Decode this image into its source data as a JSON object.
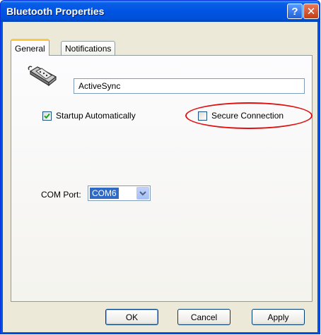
{
  "window": {
    "title": "Bluetooth Properties",
    "help_glyph": "?",
    "close_glyph": "✕"
  },
  "tabs": [
    {
      "label": "General",
      "active": true
    },
    {
      "label": "Notifications",
      "active": false
    }
  ],
  "general": {
    "device_name": "ActiveSync",
    "startup_automatically": {
      "label": "Startup Automatically",
      "checked": true
    },
    "secure_connection": {
      "label": "Secure Connection",
      "checked": false
    },
    "com_port": {
      "label": "COM Port:",
      "value": "COM6"
    }
  },
  "buttons": {
    "ok": "OK",
    "cancel": "Cancel",
    "apply": "Apply"
  },
  "icons": {
    "device": "serial-connector-icon",
    "check": "checkmark-icon",
    "dropdown": "chevron-down-icon"
  },
  "colors": {
    "titlebar": "#0054e3",
    "client_bg": "#ece9d8",
    "annotation": "#e01010",
    "selection": "#316ac5"
  }
}
